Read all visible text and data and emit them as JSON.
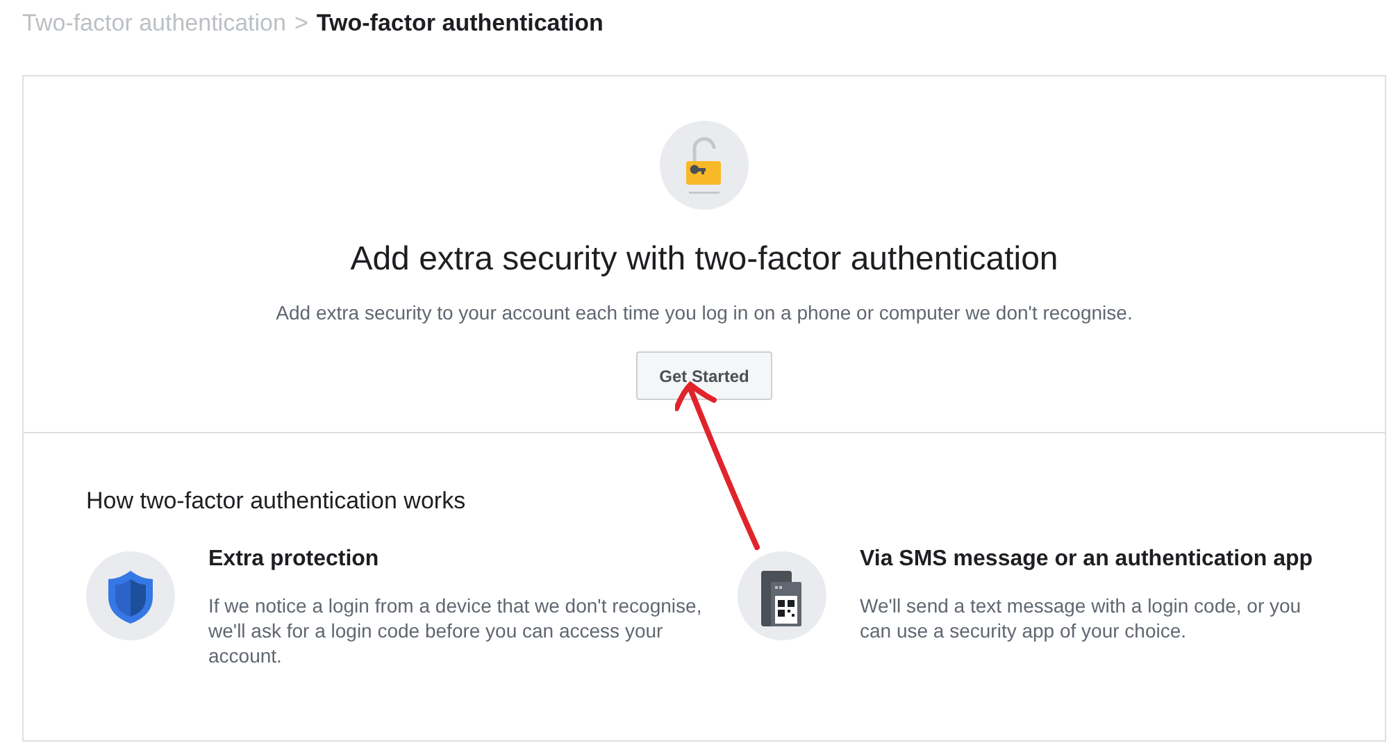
{
  "breadcrumb": {
    "parent": "Two-factor authentication",
    "separator": ">",
    "current": "Two-factor authentication"
  },
  "hero": {
    "title": "Add extra security with two-factor authentication",
    "subtitle": "Add extra security to your account each time you log in on a phone or computer we don't recognise.",
    "button": "Get Started"
  },
  "how_it_works": {
    "title": "How two-factor authentication works",
    "features": [
      {
        "kind": "shield",
        "title": "Extra protection",
        "description": "If we notice a login from a device that we don't recognise, we'll ask for a login code before you can access your account."
      },
      {
        "kind": "phone_qr",
        "title": "Via SMS message or an authentication app",
        "description": "We'll send a text message with a login code, or you can use a security app of your choice."
      }
    ]
  }
}
